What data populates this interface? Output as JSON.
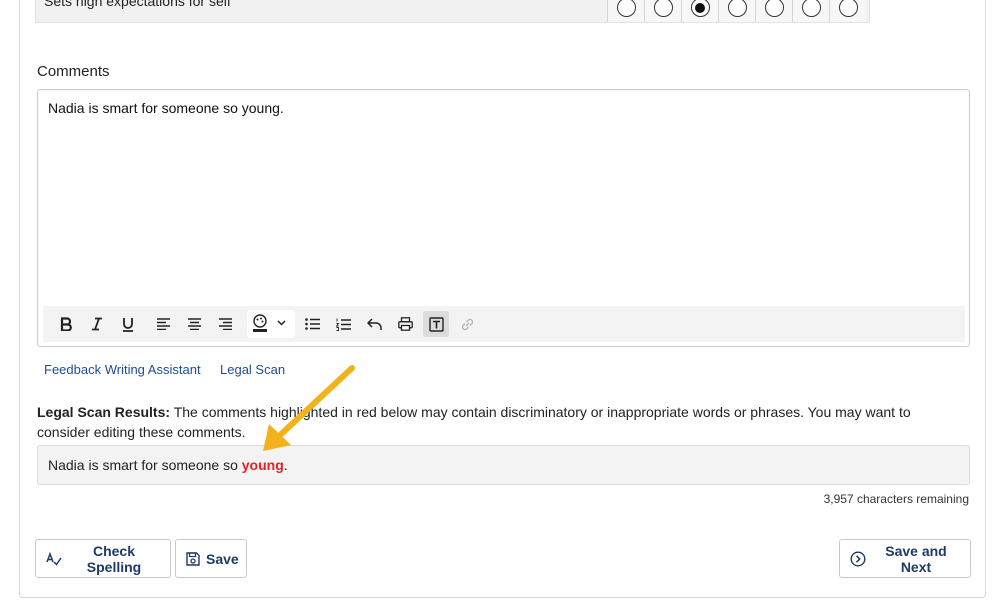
{
  "rating": {
    "label": "Sets high expectations for self",
    "options_count": 7,
    "selected_index": 2
  },
  "comments": {
    "label": "Comments",
    "text": "Nadia is smart for someone so young."
  },
  "toolbar": {
    "icons": [
      "bold-icon",
      "italic-icon",
      "underline-icon",
      "align-left-icon",
      "align-center-icon",
      "align-right-icon",
      "text-color-icon",
      "bullet-list-icon",
      "numbered-list-icon",
      "undo-icon",
      "print-icon",
      "text-box-icon",
      "link-icon"
    ]
  },
  "links": {
    "feedback_assistant": "Feedback Writing Assistant",
    "legal_scan": "Legal Scan"
  },
  "legal_scan": {
    "heading": "Legal Scan Results:",
    "description": "The comments highlighted in red below may contain discriminatory or inappropriate words or phrases. You may want to consider editing these comments.",
    "result_prefix": "Nadia is smart for someone so ",
    "flagged_word": "young",
    "result_suffix": ".",
    "highlight_color": "#e3222a"
  },
  "remaining": "3,957 characters remaining",
  "buttons": {
    "check_spelling": "Check Spelling",
    "save": "Save",
    "save_next": "Save and Next"
  },
  "annotation": {
    "arrow_color": "#f2b21b"
  }
}
